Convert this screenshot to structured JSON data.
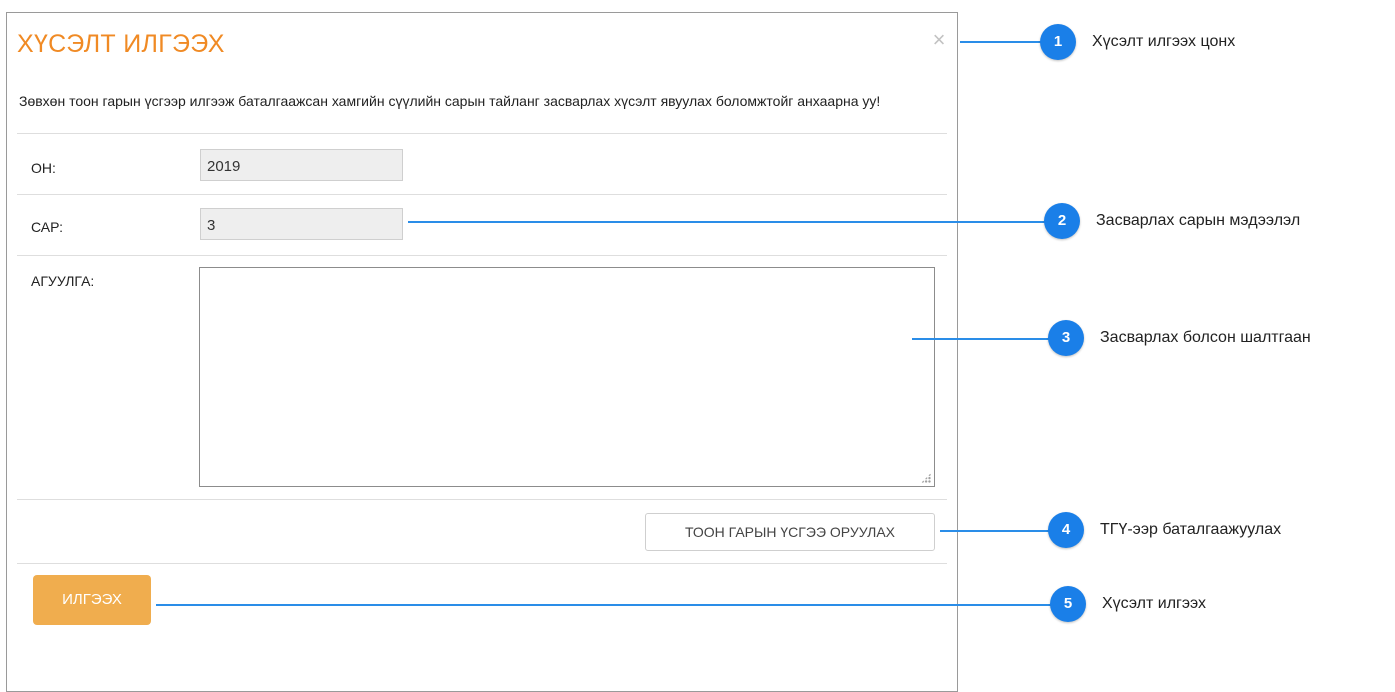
{
  "dialog": {
    "title": "ХҮСЭЛТ ИЛГЭЭХ",
    "close_symbol": "×",
    "notice": "Зөвхөн тоон гарын үсгээр илгээж баталгаажсан хамгийн сүүлийн сарын тайланг засварлах хүсэлт явуулах боломжтойг анхаарна уу!",
    "fields": {
      "year_label": "ОН:",
      "year_value": "2019",
      "month_label": "САР:",
      "month_value": "3",
      "content_label": "АГУУЛГА:",
      "content_value": ""
    },
    "sign_button_label": "ТООН ГАРЫН ҮСГЭЭ ОРУУЛАХ",
    "send_button_label": "ИЛГЭЭХ"
  },
  "callouts": [
    {
      "number": "1",
      "text": "Хүсэлт илгээх цонх"
    },
    {
      "number": "2",
      "text": "Засварлах сарын мэдээлэл"
    },
    {
      "number": "3",
      "text": "Засварлах болсон шалтгаан"
    },
    {
      "number": "4",
      "text": "ТГҮ-ээр баталгаажуулах"
    },
    {
      "number": "5",
      "text": "Хүсэлт илгээх"
    }
  ],
  "colors": {
    "title_orange": "#f08a24",
    "send_button": "#f0ad4e",
    "callout_blue": "#1a7fe8",
    "callout_line": "#2a8de8"
  },
  "icons": {
    "close": "close-icon",
    "resize": "resize-grip-icon"
  }
}
